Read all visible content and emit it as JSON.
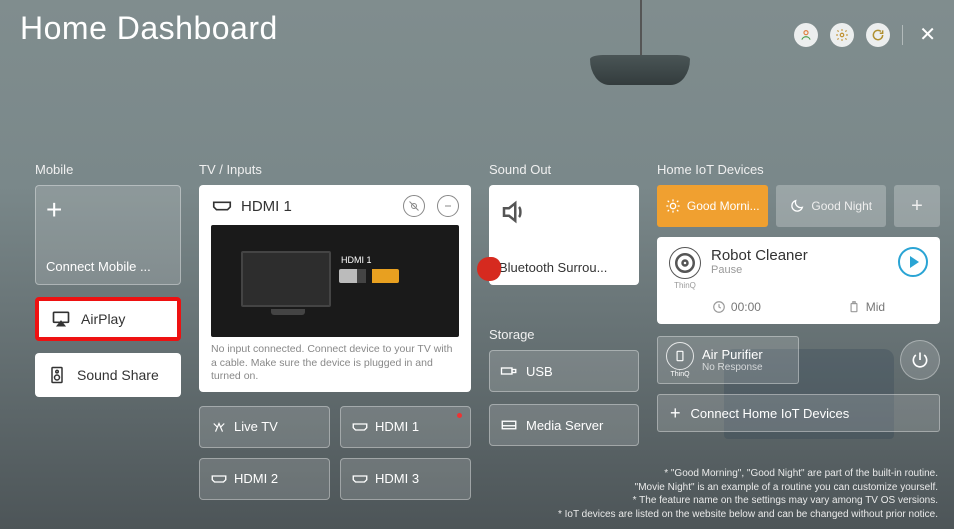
{
  "header": {
    "title": "Home Dashboard"
  },
  "mobile": {
    "label": "Mobile",
    "connect_label": "Connect Mobile ...",
    "airplay_label": "AirPlay",
    "soundshare_label": "Sound Share"
  },
  "inputs": {
    "label": "TV / Inputs",
    "active": {
      "name": "HDMI 1",
      "port_overlay": "HDMI 1",
      "message": "No input connected. Connect device to your TV with a cable. Make sure the device is plugged in and turned on."
    },
    "list": {
      "livetv": "Live TV",
      "hdmi1": "HDMI 1",
      "hdmi2": "HDMI 2",
      "hdmi3": "HDMI 3"
    }
  },
  "sound": {
    "label": "Sound Out",
    "device": "Bluetooth Surrou..."
  },
  "storage": {
    "label": "Storage",
    "usb": "USB",
    "media": "Media Server"
  },
  "iot": {
    "label": "Home IoT Devices",
    "routines": {
      "morning": "Good Morni...",
      "night": "Good Night"
    },
    "device": {
      "brand": "ThinQ",
      "name": "Robot Cleaner",
      "status": "Pause",
      "time": "00:00",
      "battery": "Mid"
    },
    "air": {
      "brand": "ThinQ",
      "name": "Air Purifier",
      "status": "No Response"
    },
    "connect_label": "Connect Home IoT Devices"
  },
  "footnotes": {
    "l1": "* \"Good Morning\", \"Good Night\" are part of the built-in routine.",
    "l2": "\"Movie Night\" is an example of a routine you can customize yourself.",
    "l3": "* The feature name on the settings may vary among TV OS versions.",
    "l4": "* IoT devices are listed on the website below and can be changed without prior notice."
  }
}
